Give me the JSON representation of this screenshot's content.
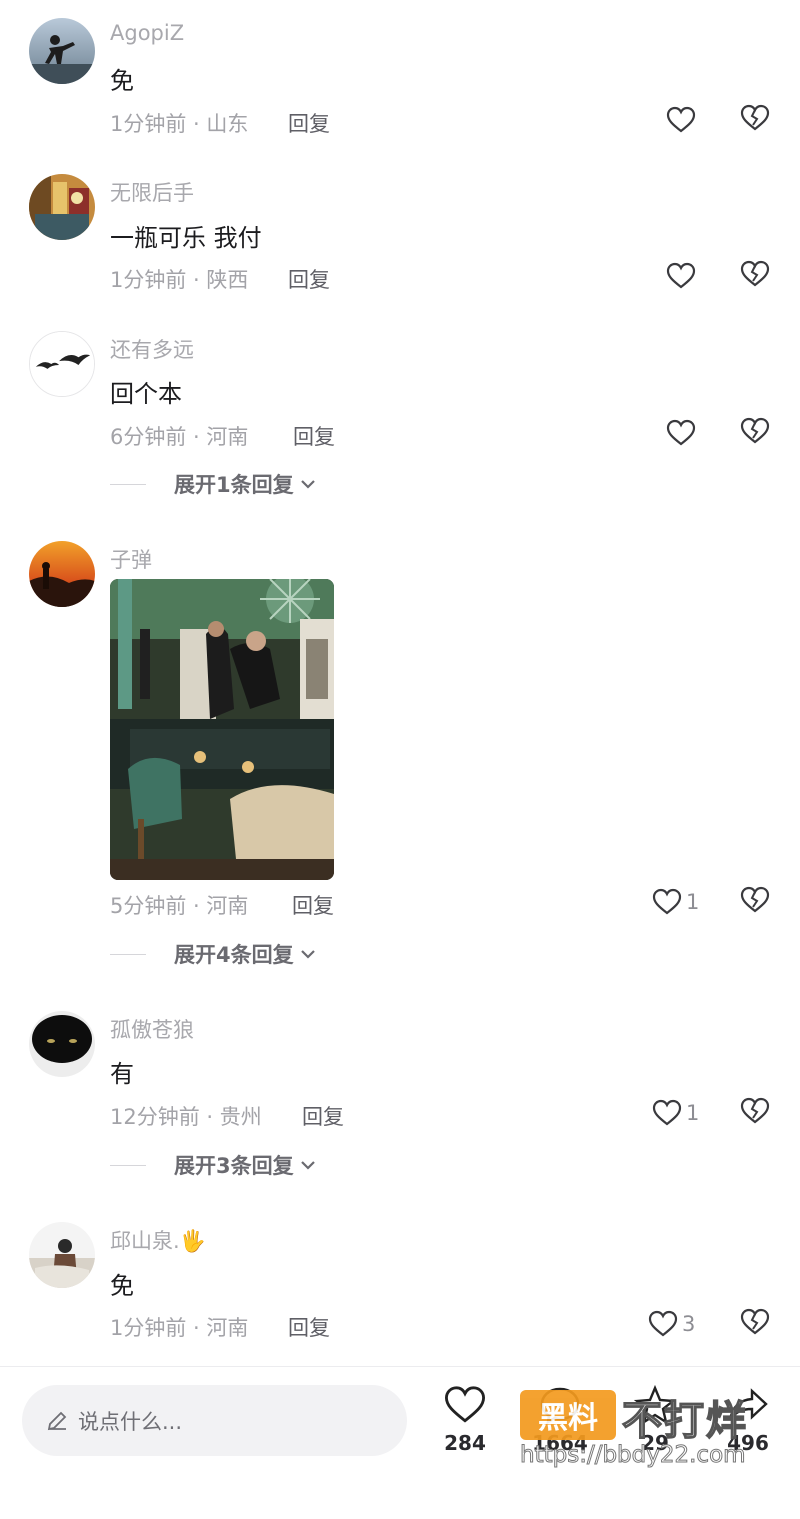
{
  "comments": [
    {
      "username": "AgopiZ",
      "text": "免",
      "time": "1分钟前 · 山东",
      "reply": "回复",
      "likes": ""
    },
    {
      "username": "无限后手",
      "text": "一瓶可乐 我付",
      "time": "1分钟前 · 陕西",
      "reply": "回复",
      "likes": ""
    },
    {
      "username": "还有多远",
      "text": "回个本",
      "time": "6分钟前 · 河南",
      "reply": "回复",
      "likes": "",
      "expand": "展开1条回复"
    },
    {
      "username": "子弹",
      "text": "",
      "time": "5分钟前 · 河南",
      "reply": "回复",
      "likes": "1",
      "expand": "展开4条回复"
    },
    {
      "username": "孤傲苍狼",
      "text": "有",
      "time": "12分钟前 · 贵州",
      "reply": "回复",
      "likes": "1",
      "expand": "展开3条回复"
    },
    {
      "username": "邱山泉.",
      "username_emoji": "🖐",
      "text": "免",
      "time": "1分钟前 · 河南",
      "reply": "回复",
      "likes": "3"
    }
  ],
  "bottom_bar": {
    "input_placeholder": "说点什么...",
    "likes_count": "284",
    "comments_count": "1664",
    "favorites_count": "29",
    "shares_count": "496"
  },
  "watermark": {
    "badge": "黑料",
    "text": "不打烊",
    "url": "https://bbdy22.com"
  },
  "colors": {
    "accent_watermark": "#f39a1e",
    "meta_text": "#a3a3a8",
    "body_text": "#1c1c1f"
  },
  "icons": [
    "heart-outline-icon",
    "broken-heart-icon",
    "chevron-down-icon",
    "pencil-icon",
    "comment-bubble-icon",
    "star-icon",
    "share-icon"
  ]
}
